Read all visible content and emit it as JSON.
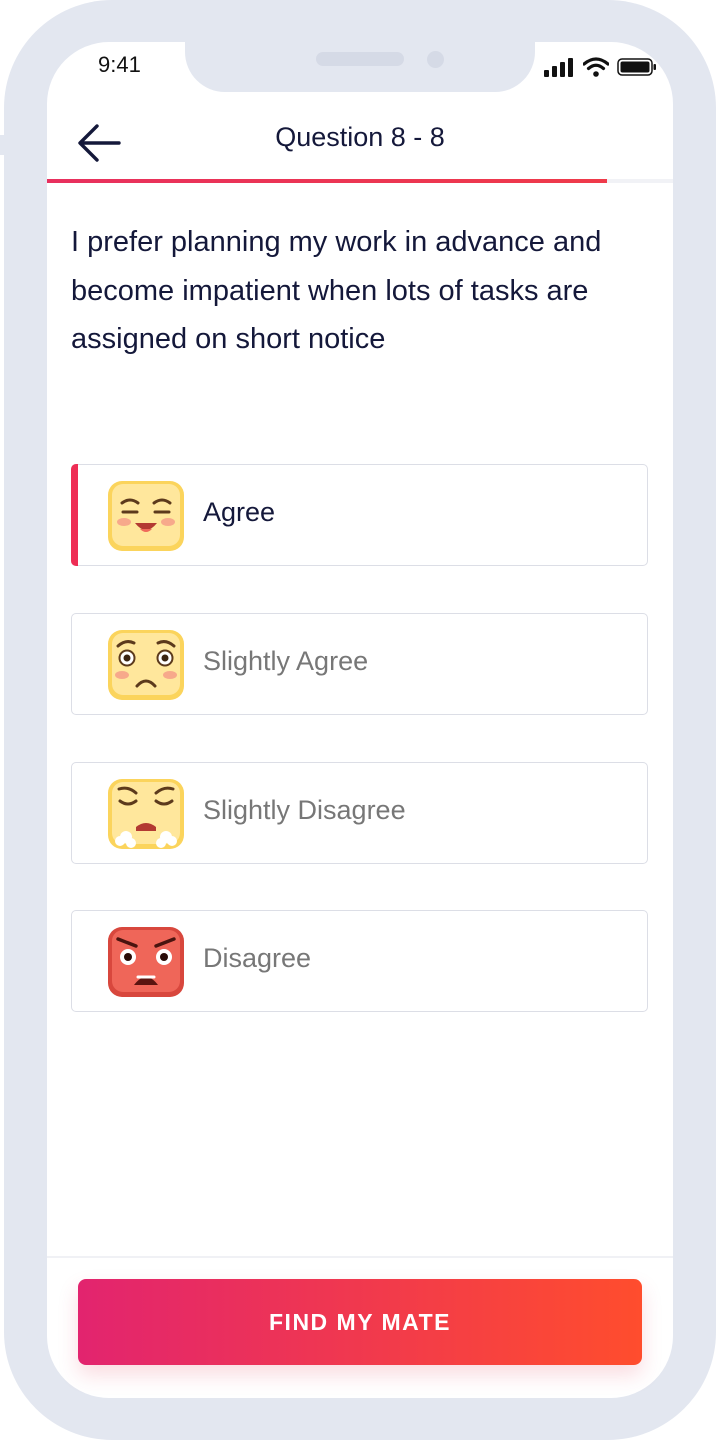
{
  "status_bar": {
    "time": "9:41",
    "icons": [
      "signal-icon",
      "wifi-icon",
      "battery-icon"
    ]
  },
  "header": {
    "title": "Question 8 - 8",
    "back_icon": "arrow-left-icon"
  },
  "progress": {
    "current": 8,
    "total": 8
  },
  "question": {
    "text": "I prefer planning my work in advance and become impatient when lots of tasks are assigned on short notice"
  },
  "options": [
    {
      "label": "Agree",
      "selected": true,
      "icon": "happy-face-icon"
    },
    {
      "label": "Slightly Agree",
      "selected": false,
      "icon": "worried-face-icon"
    },
    {
      "label": "Slightly Disagree",
      "selected": false,
      "icon": "frustrated-face-icon"
    },
    {
      "label": "Disagree",
      "selected": false,
      "icon": "angry-face-icon"
    }
  ],
  "cta": {
    "label": "FIND MY MATE"
  },
  "colors": {
    "accent": "#ee2d55",
    "gradient_start": "#e2246f",
    "gradient_end": "#ff4d2d",
    "text_dark": "#14183a"
  }
}
